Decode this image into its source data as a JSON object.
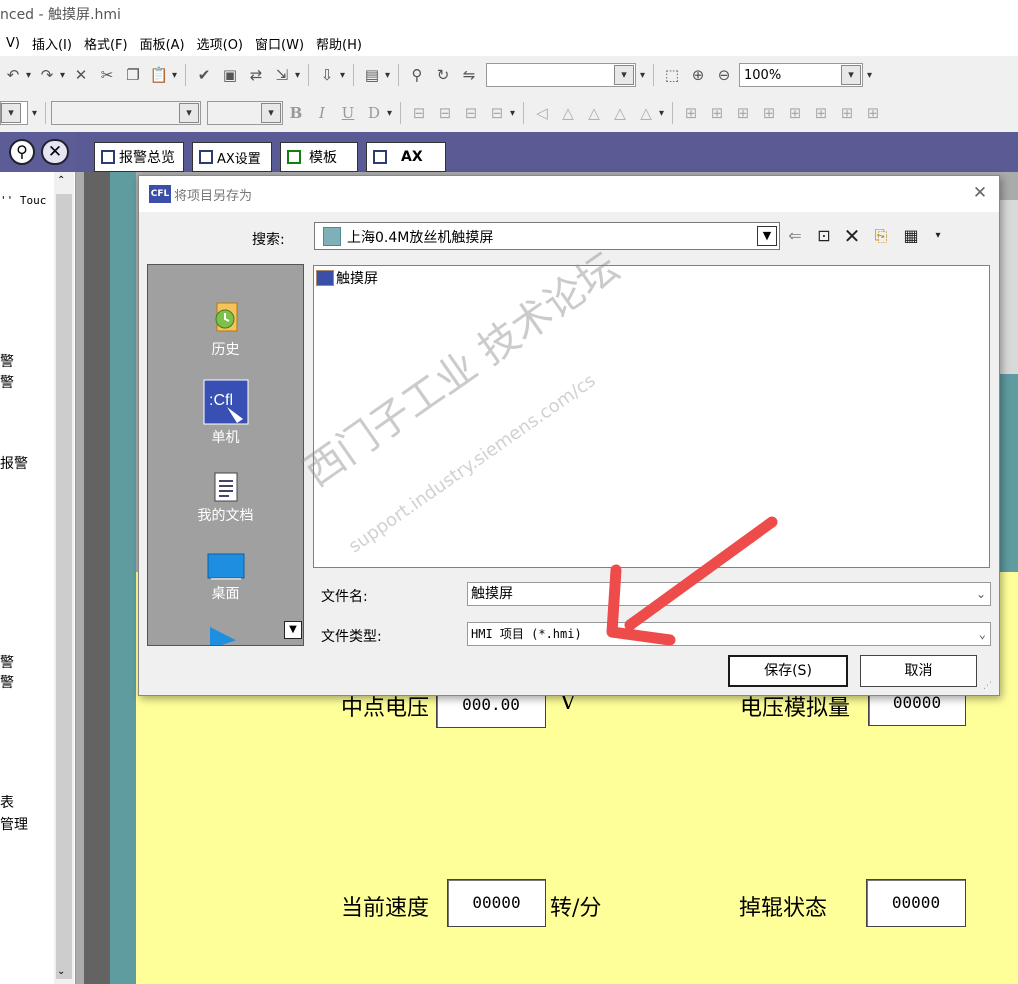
{
  "window": {
    "title": "nced - 触摸屏.hmi"
  },
  "menubar": {
    "items": [
      "V)",
      "插入(I)",
      "格式(F)",
      "面板(A)",
      "选项(O)",
      "窗口(W)",
      "帮助(H)"
    ]
  },
  "toolbar": {
    "zoom_value": "100%",
    "text_format_buttons": [
      "B",
      "I",
      "U",
      "D"
    ]
  },
  "left_panel": {
    "text_items": [
      "'' Touc",
      "警",
      "警",
      "报警",
      "警",
      "警",
      "表",
      "管理"
    ]
  },
  "tabs": [
    {
      "label": "报警总览",
      "color": "#2d3a7a"
    },
    {
      "label": "AX设置",
      "color": "#2d3a7a"
    },
    {
      "label": "模板",
      "color": "#118011"
    },
    {
      "label": "AX",
      "color": "#2d3a7a",
      "active": true
    }
  ],
  "hmi": {
    "fields": [
      {
        "label": "中点电压",
        "value": "000.00",
        "unit": "V"
      },
      {
        "label": "电压模拟量",
        "value": "00000",
        "unit": ""
      },
      {
        "label": "当前速度",
        "value": "00000",
        "unit": "转/分"
      },
      {
        "label": "掉辊状态",
        "value": "00000",
        "unit": ""
      }
    ]
  },
  "dialog": {
    "title": "将项目另存为",
    "look_in_label": "搜索:",
    "look_in_value": "上海0.4M放丝机触摸屏",
    "places": [
      {
        "label": "历史",
        "icon": "history-icon"
      },
      {
        "label": "单机",
        "icon": "computer-icon"
      },
      {
        "label": "我的文档",
        "icon": "documents-icon"
      },
      {
        "label": "桌面",
        "icon": "desktop-icon"
      }
    ],
    "file_items": [
      "触摸屏"
    ],
    "filename_label": "文件名:",
    "filename_value": "触摸屏",
    "filetype_label": "文件类型:",
    "filetype_value": "HMI 项目 (*.hmi)",
    "save_label": "保存(S)",
    "cancel_label": "取消"
  },
  "watermark": {
    "line1": "西门子工业 技术论坛",
    "line2": "support.industry.siemens.com/cs"
  },
  "colors": {
    "tabbar": "#5a5a94",
    "hmi_background": "#ffff9a",
    "annotation_arrow": "#ee4b4b"
  }
}
